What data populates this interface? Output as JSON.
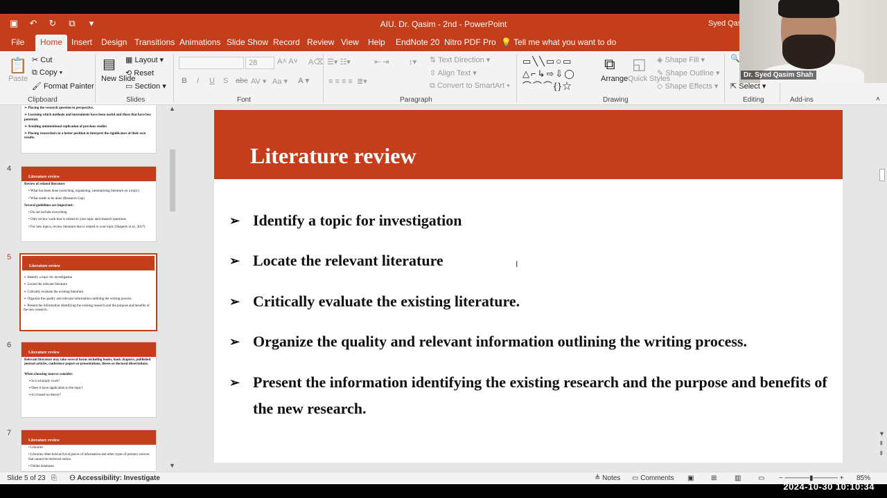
{
  "window": {
    "title": "AIU. Dr. Qasim - 2nd  -  PowerPoint",
    "user": "Syed Qasim"
  },
  "menu": {
    "tabs": [
      "File",
      "Home",
      "Insert",
      "Design",
      "Transitions",
      "Animations",
      "Slide Show",
      "Record",
      "Review",
      "View",
      "Help",
      "EndNote 20",
      "Nitro PDF Pro"
    ],
    "active": "Home",
    "tell_me": "Tell me what you want to do"
  },
  "ribbon": {
    "clipboard": {
      "paste": "Paste",
      "cut": "Cut",
      "copy": "Copy",
      "format_painter": "Format Painter",
      "label": "Clipboard"
    },
    "slides": {
      "new_slide": "New Slide",
      "layout": "Layout",
      "reset": "Reset",
      "section": "Section",
      "label": "Slides"
    },
    "font": {
      "label": "Font",
      "size": "28"
    },
    "paragraph": {
      "text_direction": "Text Direction",
      "align_text": "Align Text",
      "convert_smartart": "Convert to SmartArt",
      "label": "Paragraph"
    },
    "drawing": {
      "arrange": "Arrange",
      "quick_styles": "Quick Styles",
      "shape_fill": "Shape Fill",
      "shape_outline": "Shape Outline",
      "shape_effects": "Shape Effects",
      "label": "Drawing"
    },
    "editing": {
      "select": "Select",
      "label": "Editing"
    },
    "addins": {
      "label": "Add-ins"
    }
  },
  "thumbnails": {
    "slide3_lines": [
      "➢ Placing the research question in perspective.",
      "➢ Learning which methods and instruments have been useful and those that have less potential.",
      "➢ Avoiding unintentional replication of previous studies",
      "➢ Placing researchers in a better position to interpret the significance of their own results."
    ],
    "slide4": {
      "num": "4",
      "title": "Literature review",
      "lines": [
        "Review of related literature",
        "• What has been done (searching, organizing, summarizing literature on a topic)",
        "• What needs to be done (Research Gap)",
        "Several guidelines are important:",
        "• Do not include everything",
        "• Only review work that is related to your topic and research questions",
        "• For new topics, review literature that is related to your topic (Shaperts et al., 2017)"
      ]
    },
    "slide5": {
      "num": "5",
      "title": "Literature review",
      "lines": [
        "➢ Identify a topic for investigation",
        "➢ Locate the relevant literature",
        "➢ Critically evaluate the existing literature.",
        "➢ Organize the quality and relevant information outlining the writing process.",
        "➢ Present the information identifying the existing research and the purpose and benefits of the new research."
      ]
    },
    "slide6": {
      "num": "6",
      "title": "Literature review",
      "lines": [
        "Relevant literature may take several forms including books, book chapters, published journal articles, conference papers or presentations, theses or doctoral dissertations.",
        "When choosing sources consider:",
        "➢Is it scholarly work?",
        "➢Does it have application to the topic?",
        "➢Is it based on theory?"
      ]
    },
    "slide7": {
      "num": "7",
      "title": "Literature review",
      "lines": [
        "• Libraries",
        "• Libraries often hold archival pieces of information and other types of primary sources that cannot be retrieved online.",
        "• Online databases"
      ]
    }
  },
  "slide": {
    "title": "Literature review",
    "bullets": [
      "Identify a topic for investigation",
      "Locate the relevant literature",
      "Critically evaluate the existing literature.",
      "Organize the quality and relevant information outlining the writing process.",
      "Present the information identifying the existing research and the purpose and benefits of the new research."
    ]
  },
  "status": {
    "slide_count": "Slide 5 of 23",
    "accessibility": "Accessibility: Investigate",
    "notes": "Notes",
    "comments": "Comments",
    "zoom": "85%"
  },
  "webcam": {
    "name": "Dr. Syed Qasim Shah"
  },
  "timestamp": "2024-10-30  10:10:34",
  "colors": {
    "accent": "#c43e1c",
    "ribbon_bg": "#f3f3f3",
    "canvas_bg": "#e6e6e6"
  }
}
